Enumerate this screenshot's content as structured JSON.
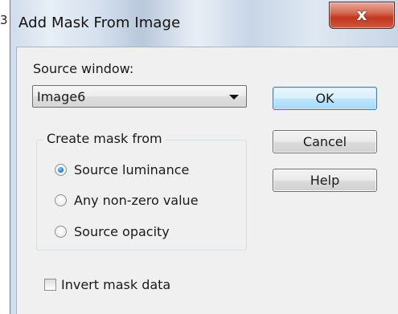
{
  "stray_char": "3",
  "window": {
    "title": "Add Mask From Image",
    "close_glyph": "x"
  },
  "source_window": {
    "label": "Source window:",
    "selected": "Image6"
  },
  "buttons": {
    "ok": "OK",
    "cancel": "Cancel",
    "help": "Help"
  },
  "create_mask": {
    "legend": "Create mask from",
    "options": [
      {
        "label": "Source luminance",
        "checked": true
      },
      {
        "label": "Any non-zero value",
        "checked": false
      },
      {
        "label": "Source opacity",
        "checked": false
      }
    ]
  },
  "invert": {
    "label": "Invert mask data",
    "checked": false
  },
  "colors": {
    "ok_border": "#3c7fb1",
    "close_red": "#c2361f",
    "dialog_bg": "#f0f0f0"
  }
}
